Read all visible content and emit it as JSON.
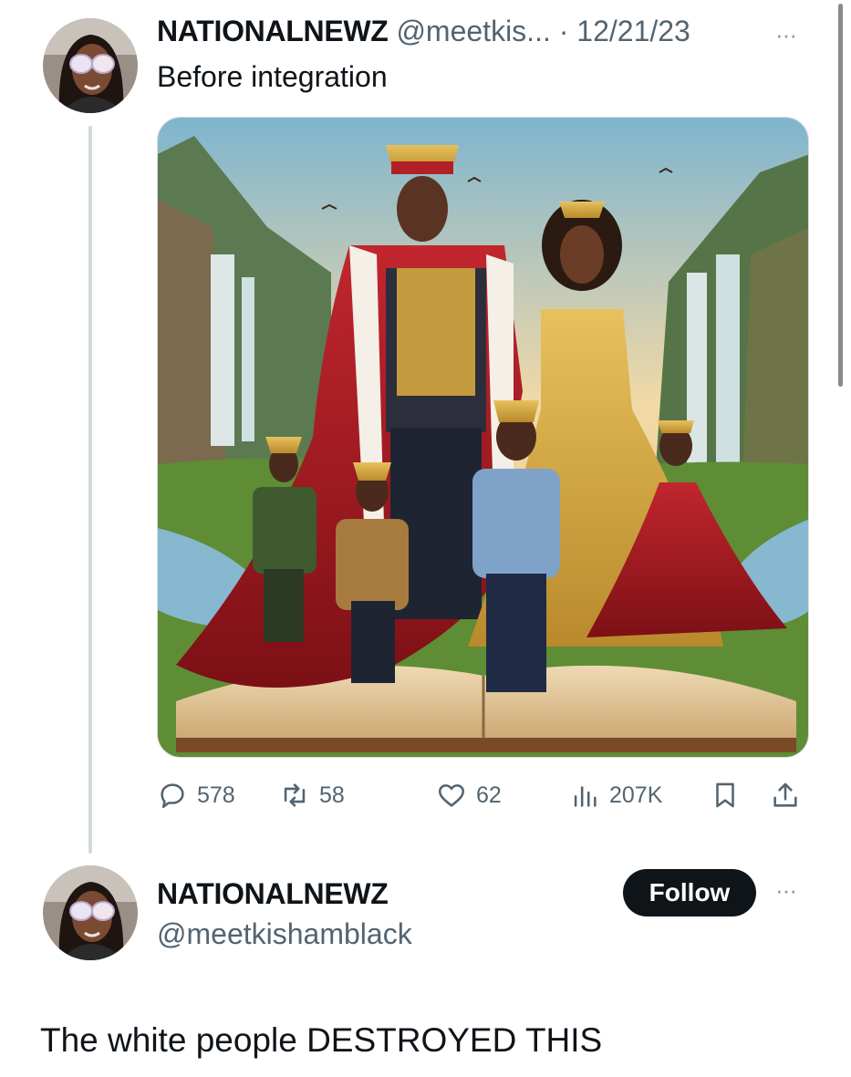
{
  "post": {
    "author_name": "NATIONALNEWZ",
    "handle": "@meetkis...",
    "separator": "·",
    "date": "12/21/23",
    "more_label": "···",
    "text": "Before integration",
    "image_alt": "Illustrated royal family with crowns standing on an open book in front of waterfalls",
    "actions": {
      "replies": "578",
      "reposts": "58",
      "likes": "62",
      "views": "207K"
    }
  },
  "quoted_profile": {
    "name": "NATIONALNEWZ",
    "handle": "@meetkishamblack",
    "follow_label": "Follow",
    "more_label": "···"
  },
  "reply_text": "The white people DESTROYED THIS",
  "colors": {
    "text_primary": "#0f1419",
    "text_secondary": "#536471",
    "follow_bg": "#0f1419",
    "thread_line": "#cfd9de"
  },
  "icons": [
    "reply-icon",
    "repost-icon",
    "like-icon",
    "views-icon",
    "bookmark-icon",
    "share-icon",
    "more-icon"
  ]
}
